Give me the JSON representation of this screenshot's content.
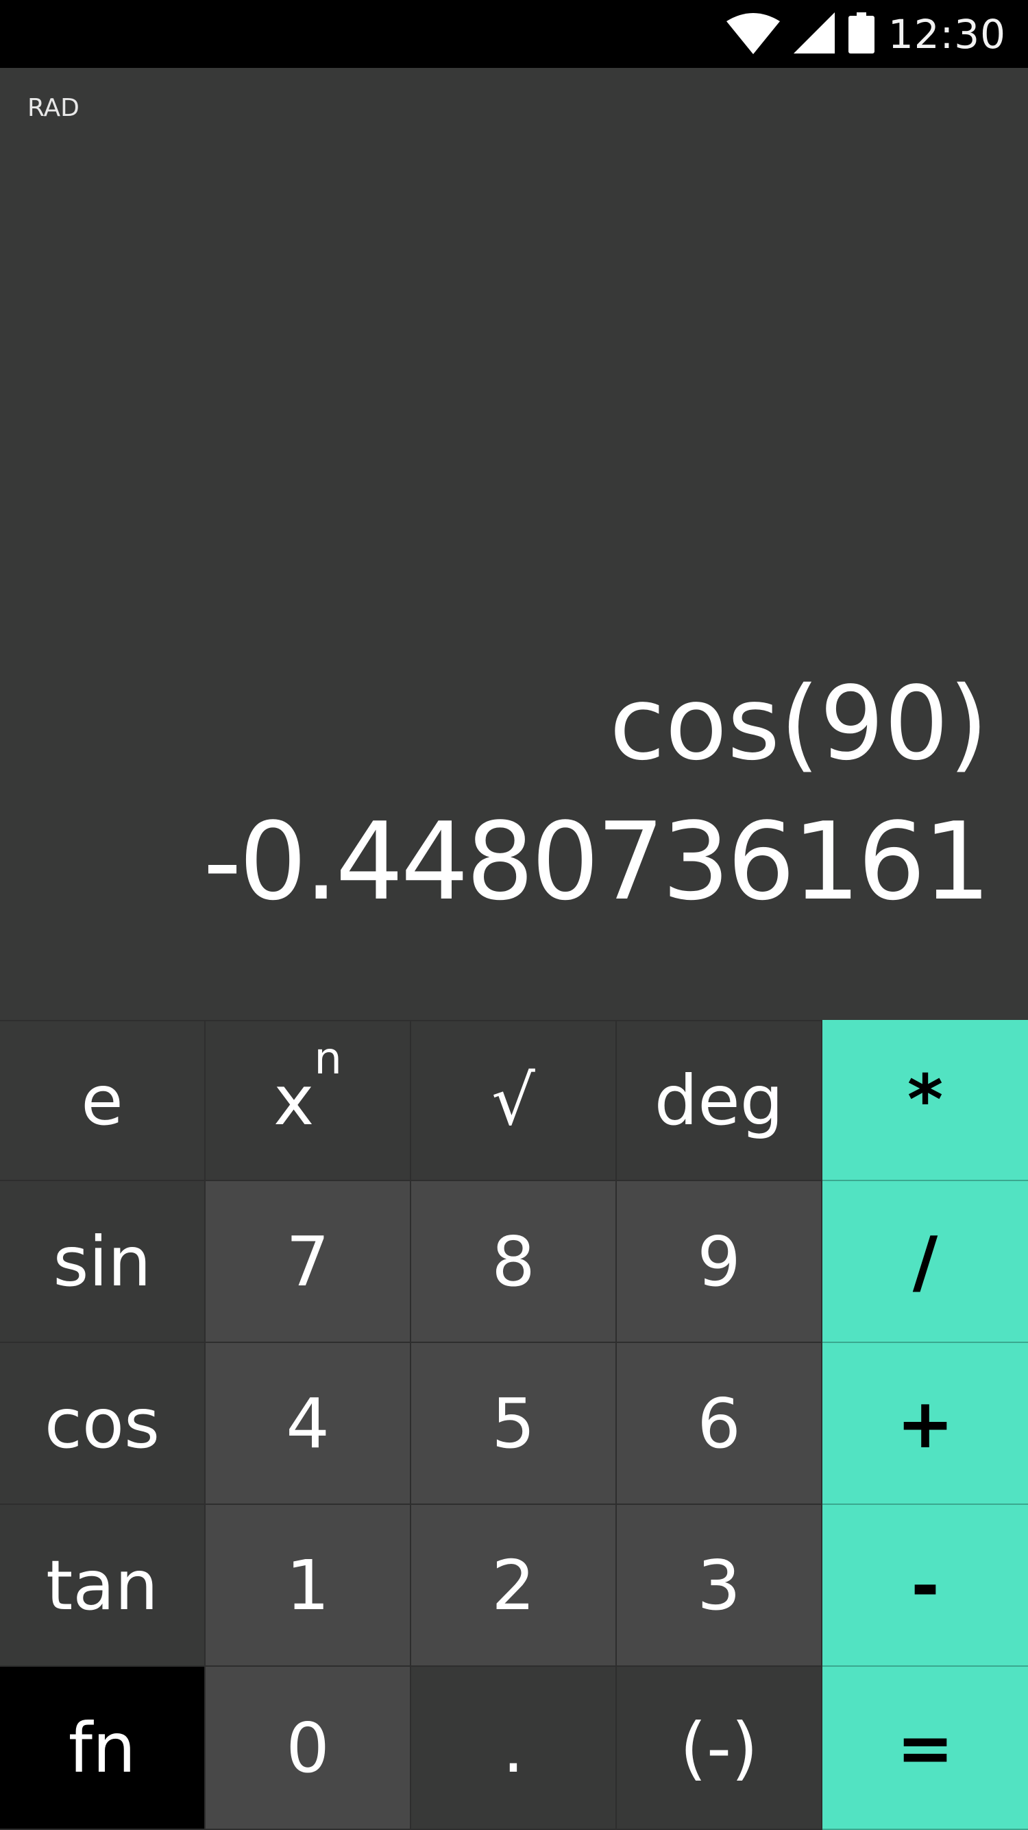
{
  "status_bar": {
    "time": "12:30",
    "icons": [
      "wifi-icon",
      "signal-icon",
      "battery-icon"
    ]
  },
  "display": {
    "mode": "RAD",
    "expression": "cos(90)",
    "result": "-0.4480736161"
  },
  "keypad": {
    "rows": [
      [
        "e",
        "x",
        "√",
        "deg",
        "*"
      ],
      [
        "sin",
        "7",
        "8",
        "9",
        "/"
      ],
      [
        "cos",
        "4",
        "5",
        "6",
        "+"
      ],
      [
        "tan",
        "1",
        "2",
        "3",
        "-"
      ],
      [
        "fn",
        "0",
        ".",
        "(-)",
        "="
      ]
    ],
    "power_exponent": "n"
  },
  "colors": {
    "display_bg": "#383938",
    "number_key_bg": "#484848",
    "function_key_bg": "#383938",
    "operator_key_bg": "#52e3c2",
    "fn_key_bg": "#000000",
    "status_bar_bg": "#000000"
  }
}
